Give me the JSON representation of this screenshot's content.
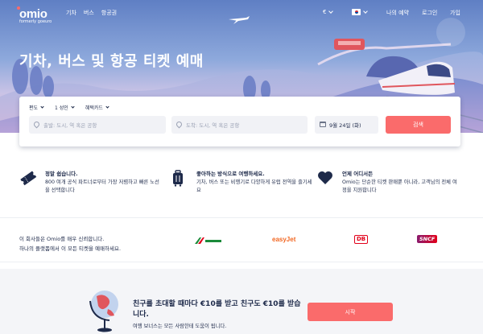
{
  "brand": {
    "logo_text": "omio",
    "logo_sub": "formerly goeuro"
  },
  "nav": {
    "links": [
      "기차",
      "버스",
      "항공권"
    ],
    "currency": "€",
    "my_booking": "나의 예약",
    "login": "로그인",
    "signup": "가입"
  },
  "hero": {
    "headline": "기차, 버스 및 항공 티켓 예매"
  },
  "search": {
    "trip_type": "편도",
    "passengers": "1 성인",
    "discount": "혜택카드",
    "from_placeholder": "출발: 도시, 역 혹은 공항",
    "to_placeholder": "도착: 도시, 역 혹은 공항",
    "date": "9월 24일 (화)",
    "search_label": "검색"
  },
  "features": [
    {
      "icon": "ticket-icon",
      "title": "정말 쉽습니다.",
      "text": "800 여개 공식 파트너로부터 가장 저렴하고 빠른 노선을 선택합니다"
    },
    {
      "icon": "luggage-icon",
      "title": "좋아하는 방식으로 여행하세요.",
      "text": "기차, 버스 또는 비행기로 다양하게 유럽 전역을 즐기세요"
    },
    {
      "icon": "heart-icon",
      "title": "언제 어디서든",
      "text": "Omio는 단순한 티켓 판매뿐 아니라, 고객님의 전체 여정을 지원합니다"
    }
  ],
  "trust": {
    "line1": "이 회사들은 Omio를 매우 신뢰합니다.",
    "line2": "하나의 플랫폼에서 이 모든 티켓을 예매하세요.",
    "partners": [
      {
        "name": "Italo",
        "color": "#1b8a3a"
      },
      {
        "name": "easyJet",
        "color": "#f26722"
      },
      {
        "name": "DB",
        "color": "#e2001a"
      },
      {
        "name": "SNCF",
        "color": "#c8155f"
      }
    ]
  },
  "referral": {
    "title": "친구를 초대할 때마다 €10를 받고 친구도 €10를 받습니다.",
    "subtitle": "여행 보너스는 모든 사람한테 도움이 됩니다.",
    "cta": "시작"
  },
  "colors": {
    "accent": "#fa6b6b",
    "navy": "#1e2a4a"
  }
}
